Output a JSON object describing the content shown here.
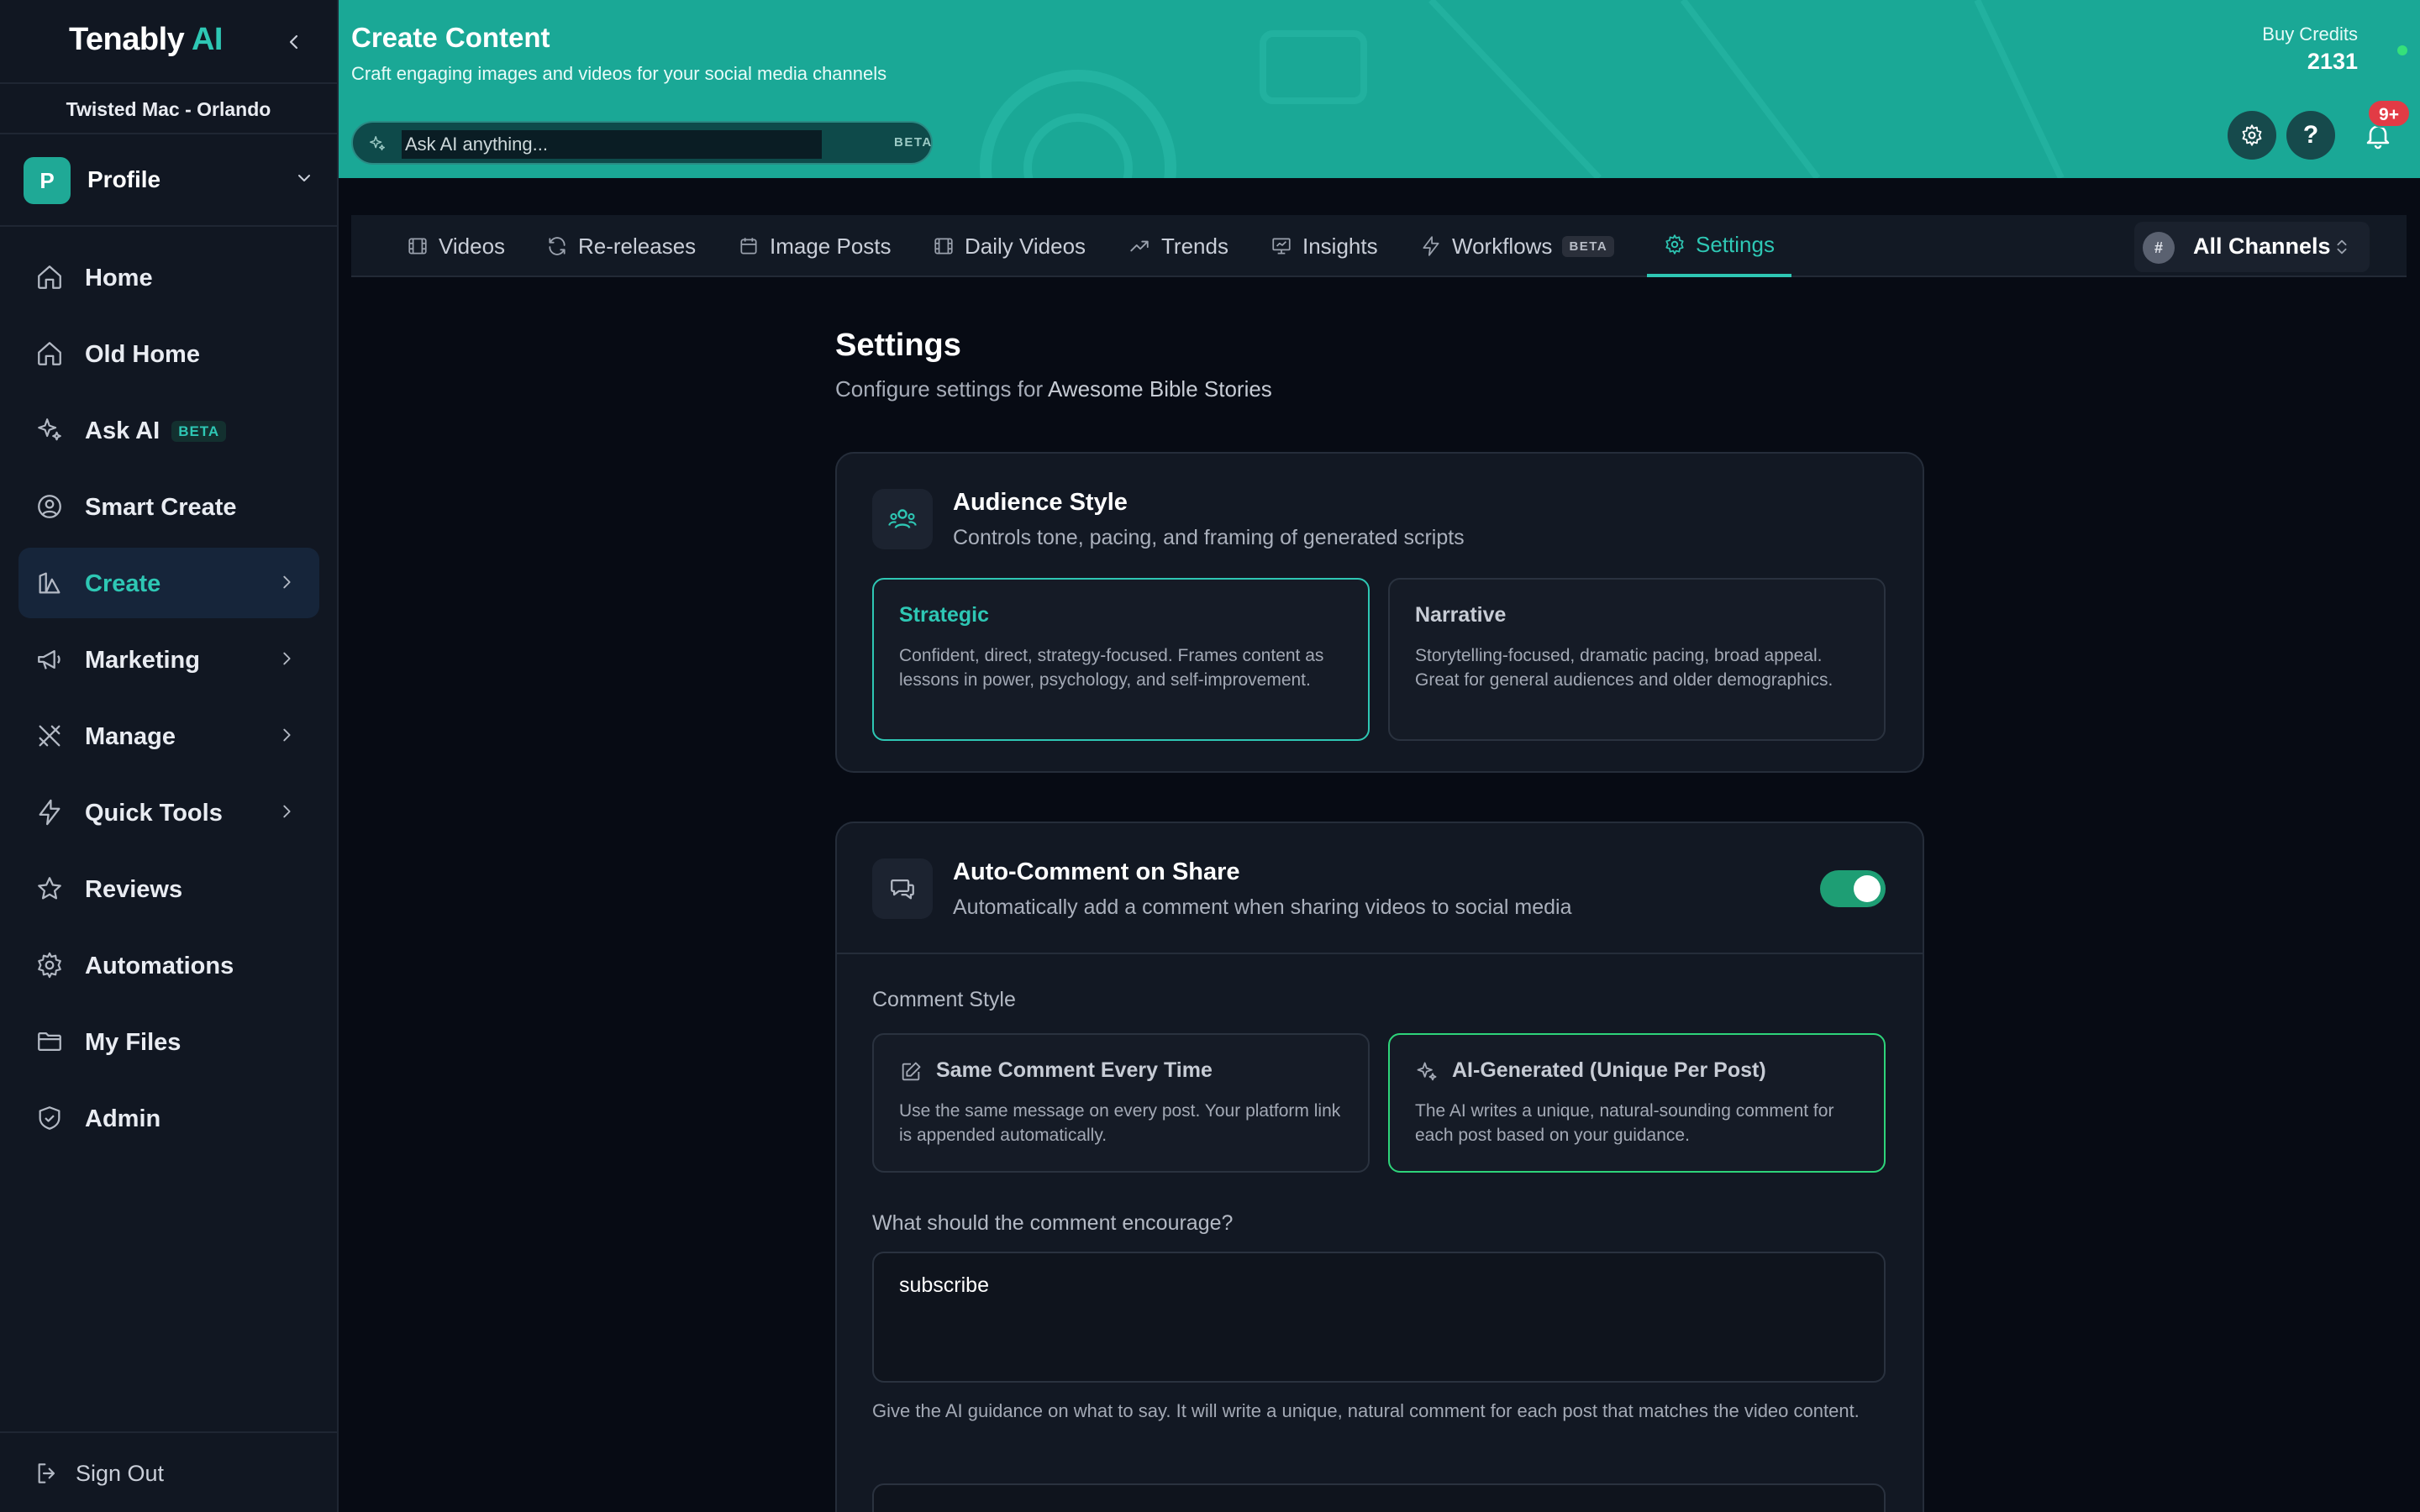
{
  "sidebar": {
    "brand_main": "Tenably",
    "brand_accent": "AI",
    "org_name": "Twisted Mac - Orlando",
    "profile_initial": "P",
    "profile_label": "Profile",
    "items": [
      {
        "label": "Home",
        "icon": "home-icon"
      },
      {
        "label": "Old Home",
        "icon": "home-icon"
      },
      {
        "label": "Ask AI",
        "icon": "sparkles-icon",
        "badge": "BETA"
      },
      {
        "label": "Smart Create",
        "icon": "user-circle-icon"
      },
      {
        "label": "Create",
        "icon": "create-icon"
      },
      {
        "label": "Marketing",
        "icon": "megaphone-icon"
      },
      {
        "label": "Manage",
        "icon": "tools-icon"
      },
      {
        "label": "Quick Tools",
        "icon": "bolt-icon"
      },
      {
        "label": "Reviews",
        "icon": "star-icon"
      },
      {
        "label": "Automations",
        "icon": "gear-icon"
      },
      {
        "label": "My Files",
        "icon": "folder-icon"
      },
      {
        "label": "Admin",
        "icon": "shield-icon"
      }
    ],
    "sign_out": "Sign Out"
  },
  "header": {
    "title": "Create Content",
    "subtitle": "Craft engaging images and videos for your social media channels",
    "ask_placeholder": "Ask AI anything...",
    "ask_beta": "BETA",
    "credits_label": "Buy Credits",
    "credits_value": "2131",
    "notif_count": "9+",
    "help_label": "?"
  },
  "tabs": [
    {
      "label": "Videos",
      "icon": "film-icon"
    },
    {
      "label": "Re-releases",
      "icon": "refresh-icon"
    },
    {
      "label": "Image Posts",
      "icon": "calendar-icon"
    },
    {
      "label": "Daily Videos",
      "icon": "film-icon"
    },
    {
      "label": "Trends",
      "icon": "trend-icon"
    },
    {
      "label": "Insights",
      "icon": "presentation-icon"
    },
    {
      "label": "Workflows",
      "icon": "bolt-icon",
      "badge": "BETA"
    },
    {
      "label": "Settings",
      "icon": "gear-icon"
    }
  ],
  "channels": {
    "hash": "#",
    "label": "All Channels"
  },
  "page": {
    "title": "Settings",
    "subtitle_prefix": "Configure settings for",
    "channel_name": "Awesome Bible Stories"
  },
  "audience": {
    "title": "Audience Style",
    "subtitle": "Controls tone, pacing, and framing of generated scripts",
    "options": [
      {
        "title": "Strategic",
        "desc": "Confident, direct, strategy-focused. Frames content as lessons in power, psychology, and self-improvement."
      },
      {
        "title": "Narrative",
        "desc": "Storytelling-focused, dramatic pacing, broad appeal. Great for general audiences and older demographics."
      }
    ]
  },
  "auto_comment": {
    "title": "Auto-Comment on Share",
    "subtitle": "Automatically add a comment when sharing videos to social media",
    "enabled": true,
    "style_label": "Comment Style",
    "options": [
      {
        "title": "Same Comment Every Time",
        "desc": "Use the same message on every post. Your platform link is appended automatically."
      },
      {
        "title": "AI-Generated (Unique Per Post)",
        "desc": "The AI writes a unique, natural-sounding comment for each post based on your guidance."
      }
    ],
    "encourage_label": "What should the comment encourage?",
    "encourage_value": "subscribe",
    "help_text": "Give the AI guidance on what to say. It will write a unique, natural comment for each post that matches the video content."
  },
  "colors": {
    "accent": "#2ec7b4",
    "header_bg": "#1aa896",
    "toggle_on": "#1e9e74",
    "selected_green": "#2ed47a",
    "badge_red": "#e23b45"
  }
}
